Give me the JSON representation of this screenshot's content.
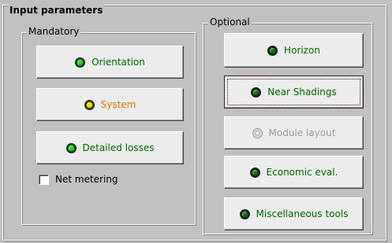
{
  "input_parameters": {
    "title": "Input parameters"
  },
  "mandatory": {
    "title": "Mandatory",
    "buttons": [
      {
        "label": "Orientation",
        "status": "green",
        "text_color": "#006400"
      },
      {
        "label": "System",
        "status": "yellow",
        "text_color": "#e07000"
      },
      {
        "label": "Detailed losses",
        "status": "green",
        "text_color": "#006400"
      }
    ],
    "net_metering": {
      "label": "Net metering",
      "checked": false
    }
  },
  "optional": {
    "title": "Optional",
    "buttons": [
      {
        "label": "Horizon",
        "status": "dark",
        "text_color": "#006400"
      },
      {
        "label": "Near Shadings",
        "status": "dark",
        "text_color": "#006400",
        "focused": true
      },
      {
        "label": "Module layout",
        "status": "disabled",
        "text_color": "#9c9c9c",
        "disabled": true
      },
      {
        "label": "Economic eval.",
        "status": "dark",
        "text_color": "#006400"
      },
      {
        "label": "Miscellaneous tools",
        "status": "dark",
        "text_color": "#006400"
      }
    ]
  },
  "colors": {
    "panel_background": "#c0c0c0",
    "button_face": "#ececec",
    "ok_text": "#006400",
    "warning_text": "#e07000",
    "disabled_text": "#9c9c9c"
  }
}
